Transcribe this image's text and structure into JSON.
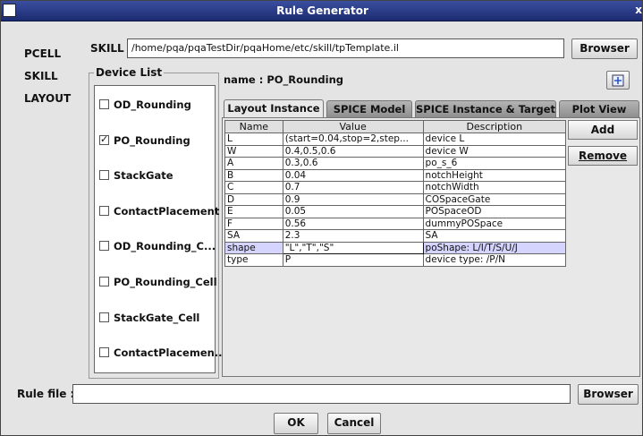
{
  "window": {
    "title": "Rule Generator",
    "close_glyph": "x"
  },
  "left_nav": [
    "PCELL",
    "SKILL",
    "LAYOUT"
  ],
  "skill": {
    "label": "SKILL",
    "path": "/home/pqa/pqaTestDir/pqaHome/etc/skill/tpTemplate.il",
    "browse_label": "Browser"
  },
  "device_list": {
    "title": "Device List",
    "items": [
      {
        "label": "OD_Rounding",
        "checked": false
      },
      {
        "label": "PO_Rounding",
        "checked": true
      },
      {
        "label": "StackGate",
        "checked": false
      },
      {
        "label": "ContactPlacement",
        "checked": false
      },
      {
        "label": "OD_Rounding_C...",
        "checked": false
      },
      {
        "label": "PO_Rounding_Cell",
        "checked": false
      },
      {
        "label": "StackGate_Cell",
        "checked": false
      },
      {
        "label": "ContactPlacemen...",
        "checked": false
      }
    ]
  },
  "name_label": "name : PO_Rounding",
  "tabs": [
    "Layout Instance",
    "SPICE Model",
    "SPICE Instance & Target",
    "Plot View"
  ],
  "table": {
    "headers": [
      "Name",
      "Value",
      "Description"
    ],
    "rows": [
      [
        "L",
        "(start=0.04,stop=2,step...",
        "device L"
      ],
      [
        "W",
        "0.4,0.5,0.6",
        "device W"
      ],
      [
        "A",
        "0.3,0.6",
        "po_s_6"
      ],
      [
        "B",
        "0.04",
        "notchHeight"
      ],
      [
        "C",
        "0.7",
        "notchWidth"
      ],
      [
        "D",
        "0.9",
        "COSpaceGate"
      ],
      [
        "E",
        "0.05",
        "POSpaceOD"
      ],
      [
        "F",
        "0.56",
        "dummyPOSpace"
      ],
      [
        "SA",
        "2.3",
        "SA"
      ],
      [
        "shape",
        "\"L\",\"T\",\"S\"",
        "poShape: L/I/T/S/U/J"
      ],
      [
        "type",
        "P",
        "device type: /P/N"
      ]
    ],
    "selected_row": 9
  },
  "side_buttons": {
    "add": "Add",
    "remove": "Remove"
  },
  "rule_file": {
    "label": "Rule file :",
    "value": "",
    "browse_label": "Browser"
  },
  "footer": {
    "ok": "OK",
    "cancel": "Cancel"
  },
  "icons": {
    "insert": "insert-icon"
  }
}
